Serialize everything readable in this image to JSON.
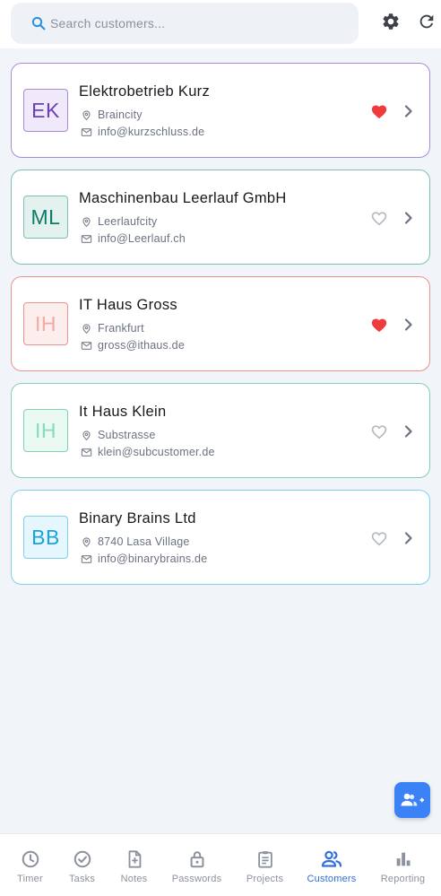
{
  "search": {
    "placeholder": "Search customers..."
  },
  "toolbar": {
    "settings_icon": "gear-icon",
    "refresh_icon": "refresh-icon"
  },
  "customers": [
    {
      "initials": "EK",
      "name": "Elektrobetrieb Kurz",
      "city": "Braincity",
      "email": "info@kurzschluss.de",
      "favorite": true,
      "accent": "#a78bdb",
      "avatar_bg": "#efe9fa",
      "avatar_fg": "#6b3fb6"
    },
    {
      "initials": "ML",
      "name": "Maschinenbau Leerlauf GmbH",
      "city": "Leerlaufcity",
      "email": "info@Leerlauf.ch",
      "favorite": false,
      "accent": "#7fbfb3",
      "avatar_bg": "#e3f2ef",
      "avatar_fg": "#0f7a68"
    },
    {
      "initials": "IH",
      "name": "IT Haus Gross",
      "city": "Frankfurt",
      "email": "gross@ithaus.de",
      "favorite": true,
      "accent": "#f08f8f",
      "avatar_bg": "#fdeeee",
      "avatar_fg": "#f4a9a9"
    },
    {
      "initials": "IH",
      "name": "It Haus Klein",
      "city": "Substrasse",
      "email": "klein@subcustomer.de",
      "favorite": false,
      "accent": "#7dd3b0",
      "avatar_bg": "#eafaf3",
      "avatar_fg": "#86dcb9"
    },
    {
      "initials": "BB",
      "name": "Binary Brains Ltd",
      "city": "8740 Lasa Village",
      "email": "info@binarybrains.de",
      "favorite": false,
      "accent": "#7fd0ea",
      "avatar_bg": "#e6f6fd",
      "avatar_fg": "#17a3de"
    }
  ],
  "fab": {
    "icon": "add-user-icon"
  },
  "nav": [
    {
      "key": "timer",
      "label": "Timer",
      "icon": "clock-icon",
      "active": false
    },
    {
      "key": "tasks",
      "label": "Tasks",
      "icon": "check-circle-icon",
      "active": false
    },
    {
      "key": "notes",
      "label": "Notes",
      "icon": "note-add-icon",
      "active": false
    },
    {
      "key": "passwords",
      "label": "Passwords",
      "icon": "lock-icon",
      "active": false
    },
    {
      "key": "projects",
      "label": "Projects",
      "icon": "clipboard-icon",
      "active": false
    },
    {
      "key": "customers",
      "label": "Customers",
      "icon": "people-icon",
      "active": true
    },
    {
      "key": "reporting",
      "label": "Reporting",
      "icon": "bar-chart-icon",
      "active": false
    }
  ],
  "colors": {
    "primary": "#2f6fe0",
    "favorite": "#ef3b3b",
    "inactive": "#8b929d",
    "search_icon": "#2b8fe0"
  }
}
